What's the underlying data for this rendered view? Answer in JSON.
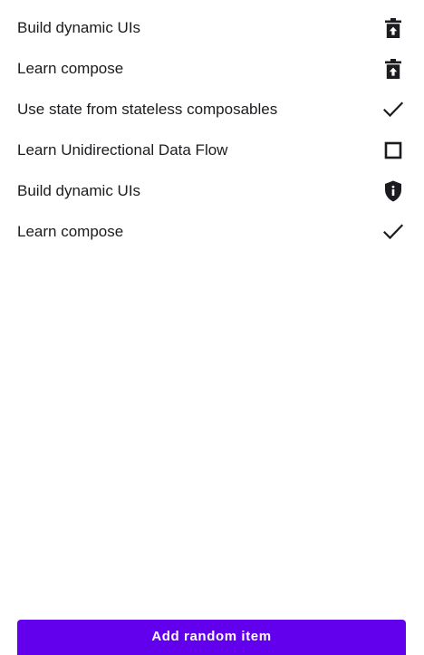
{
  "todo_list": {
    "items": [
      {
        "label": "Build dynamic UIs",
        "icon": "delete-icon"
      },
      {
        "label": "Learn compose",
        "icon": "delete-icon"
      },
      {
        "label": "Use state from stateless composables",
        "icon": "check-icon"
      },
      {
        "label": "Learn Unidirectional Data Flow",
        "icon": "checkbox-outline-icon"
      },
      {
        "label": "Build dynamic UIs",
        "icon": "shield-info-icon"
      },
      {
        "label": "Learn compose",
        "icon": "check-icon"
      }
    ]
  },
  "add_button": {
    "label": "Add random item"
  },
  "colors": {
    "accent": "#6200ee",
    "text": "#1c1b1f",
    "icon": "#1c1b1f",
    "background": "#ffffff"
  }
}
